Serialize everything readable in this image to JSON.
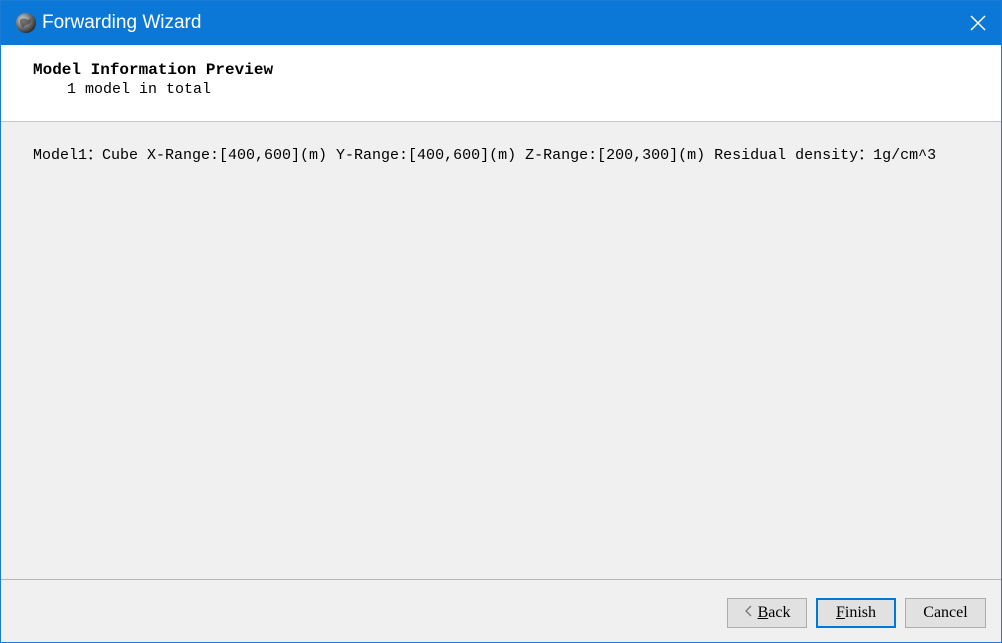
{
  "window": {
    "title": "Forwarding Wizard",
    "app_icon": "globe-icon",
    "close_icon": "close-icon"
  },
  "header": {
    "title": "Model Information Preview",
    "subtitle": "1 model in total"
  },
  "content": {
    "models": [
      {
        "line": "Model1：Cube   X-Range:[400,600](m) Y-Range:[400,600](m) Z-Range:[200,300](m) Residual density：1g/cm^3"
      }
    ]
  },
  "buttons": {
    "back": {
      "mnemonic": "B",
      "rest": "ack",
      "icon": "chevron-left-icon"
    },
    "finish": {
      "mnemonic": "F",
      "rest": "inish"
    },
    "cancel": {
      "label": "Cancel"
    }
  },
  "colors": {
    "titlebar": "#0b78d7",
    "content_bg": "#f0f0f0",
    "default_button_border": "#0078d7"
  }
}
